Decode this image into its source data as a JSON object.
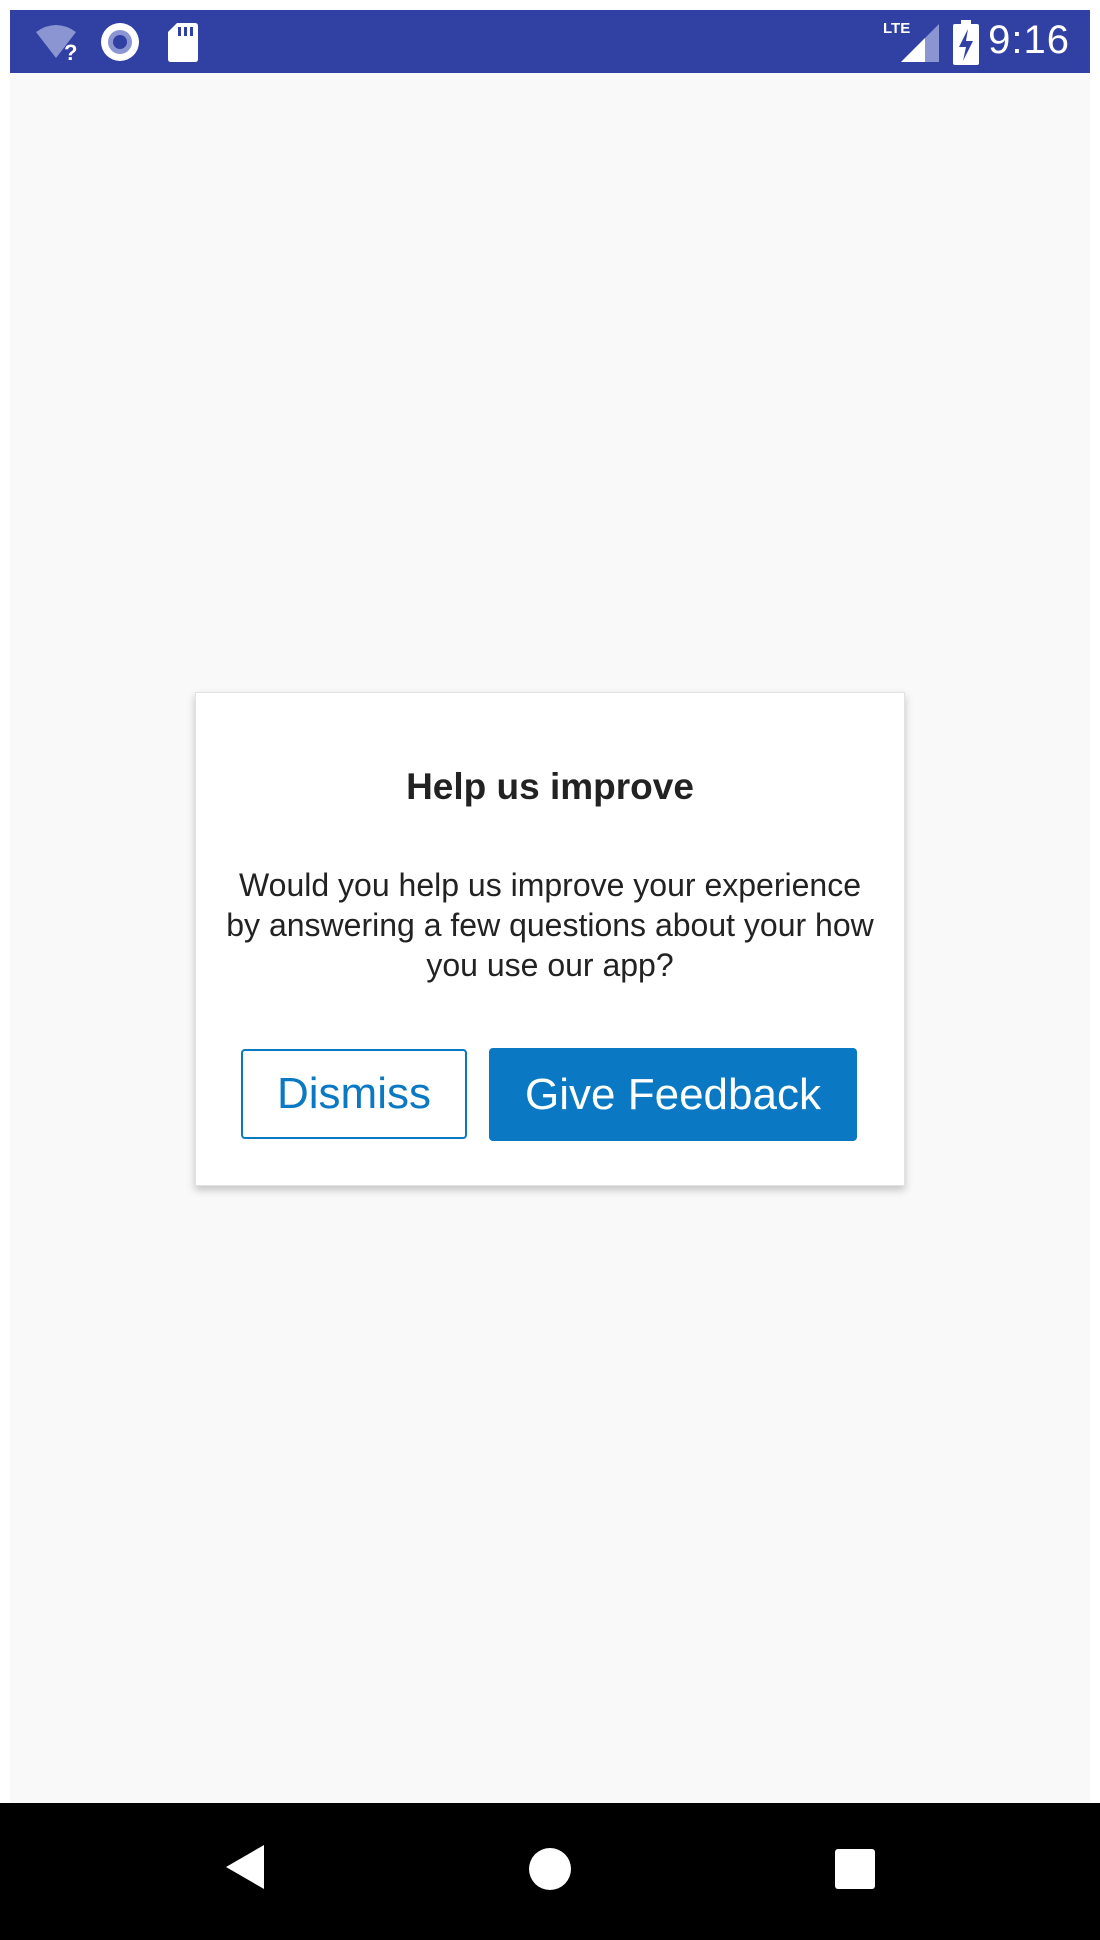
{
  "status_bar": {
    "time": "9:16",
    "network_label": "LTE",
    "background_color": "#3141a3",
    "icons": [
      "wifi-unknown-icon",
      "record-icon",
      "sd-card-icon",
      "lte-signal-icon",
      "battery-charging-icon"
    ]
  },
  "dialog": {
    "title": "Help us improve",
    "message": "Would you help us improve your experience by answering a few questions about your how you use our app?",
    "dismiss_label": "Dismiss",
    "feedback_label": "Give Feedback",
    "accent_color": "#0a78c2"
  },
  "nav_bar": {
    "icons": [
      "back-icon",
      "home-icon",
      "recents-icon"
    ]
  }
}
